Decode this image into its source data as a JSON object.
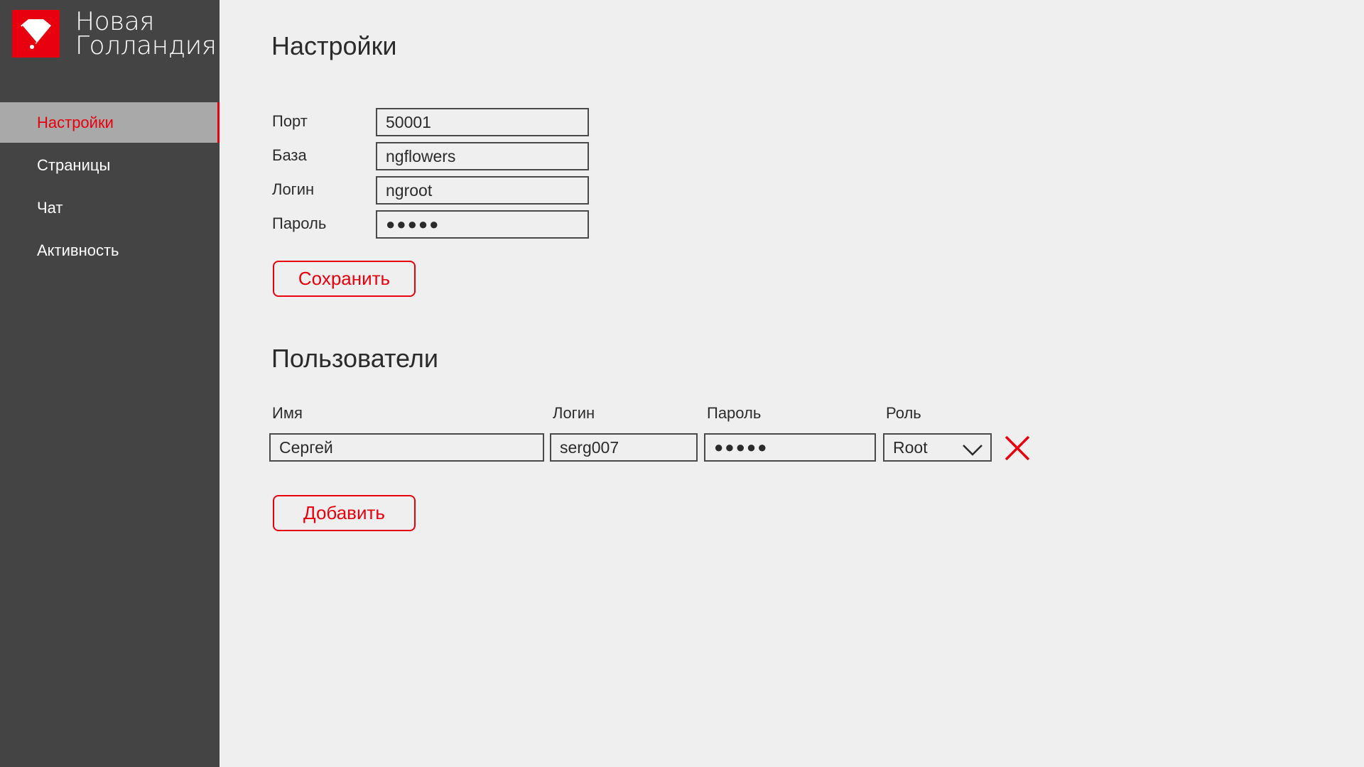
{
  "brand": {
    "name_line1": "Новая",
    "name_line2": "Голландия",
    "logo_icon": "diamond-logo-icon",
    "accent_color": "#e8000e"
  },
  "sidebar": {
    "items": [
      {
        "label": "Настройки",
        "active": true
      },
      {
        "label": "Страницы",
        "active": false
      },
      {
        "label": "Чат",
        "active": false
      },
      {
        "label": "Активность",
        "active": false
      }
    ]
  },
  "settings": {
    "title": "Настройки",
    "fields": [
      {
        "label": "Порт",
        "value": "50001"
      },
      {
        "label": "База",
        "value": "ngflowers"
      },
      {
        "label": "Логин",
        "value": "ngroot"
      },
      {
        "label": "Пароль",
        "value": "●●●●●"
      }
    ],
    "save_label": "Сохранить"
  },
  "users": {
    "title": "Пользователи",
    "columns": [
      "Имя",
      "Логин",
      "Пароль",
      "Роль"
    ],
    "rows": [
      {
        "name": "Сергей",
        "login": "serg007",
        "password": "●●●●●",
        "role": "Root"
      }
    ],
    "delete_icon": "close-x-icon",
    "add_label": "Добавить"
  }
}
